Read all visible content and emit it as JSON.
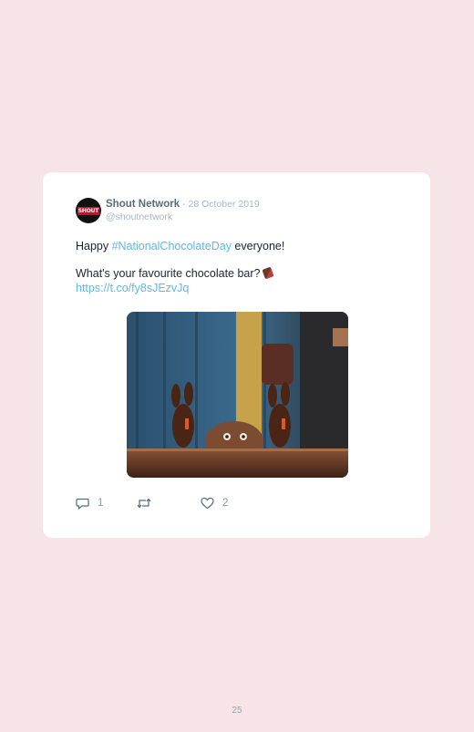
{
  "tweet": {
    "author_name": "Shout Network",
    "separator": " - ",
    "date": "28 October 2019",
    "handle": "@shoutnetwork",
    "avatar_text": "SHOUT",
    "line1_prefix": "Happy ",
    "hashtag": "#NationalChocolateDay",
    "line1_suffix": " everyone!",
    "line2": "What's your favourite chocolate bar?",
    "link": "https://t.co/fy8sJEzvJq",
    "media_icon": "chocolate-bunnies-gif"
  },
  "actions": {
    "reply_count": "1",
    "retweet_count": "",
    "like_count": "2"
  },
  "footer": {
    "page_number": "25"
  },
  "colors": {
    "background": "#f6e4e6",
    "card": "#ffffff",
    "link": "#5fb8e8"
  }
}
